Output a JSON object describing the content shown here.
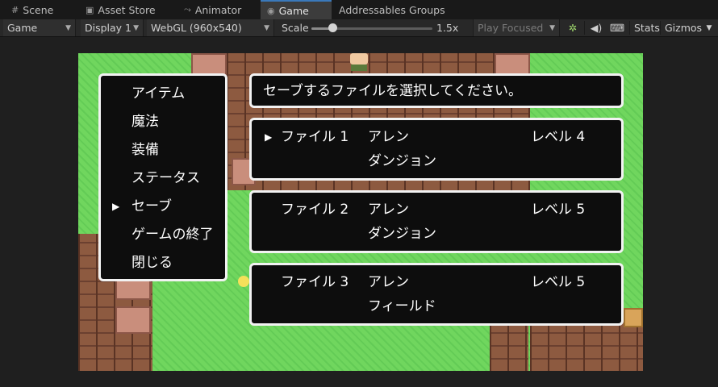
{
  "tabs": [
    {
      "label": "Scene",
      "icon": "grid-icon"
    },
    {
      "label": "Asset Store",
      "icon": "bag-icon"
    },
    {
      "label": "Animator",
      "icon": "animator-icon"
    },
    {
      "label": "Game",
      "icon": "gamepad-icon",
      "active": true
    },
    {
      "label": "Addressables Groups"
    }
  ],
  "toolbar": {
    "display_mode": "Game",
    "display": "Display 1",
    "resolution": "WebGL (960x540)",
    "scale_label": "Scale",
    "scale_value": "1.5x",
    "scale_fraction": 0.17,
    "play_mode": "Play Focused",
    "stats": "Stats",
    "gizmos": "Gizmos"
  },
  "menu": {
    "items": [
      "アイテム",
      "魔法",
      "装備",
      "ステータス",
      "セーブ",
      "ゲームの終了",
      "閉じる"
    ],
    "selected_index": 4,
    "cursor": "▶"
  },
  "prompt": "セーブするファイルを選択してください。",
  "save_slots": [
    {
      "file": "ファイル 1",
      "name": "アレン",
      "level": "レベル 4",
      "location": "ダンジョン",
      "selected": true
    },
    {
      "file": "ファイル 2",
      "name": "アレン",
      "level": "レベル 5",
      "location": "ダンジョン",
      "selected": false
    },
    {
      "file": "ファイル 3",
      "name": "アレン",
      "level": "レベル 5",
      "location": "フィールド",
      "selected": false
    }
  ],
  "colors": {
    "window_bg": "#0d0d0d",
    "window_border": "#f2f2f2",
    "grass": "#70d65e",
    "active_tab_accent": "#3a79bb"
  }
}
